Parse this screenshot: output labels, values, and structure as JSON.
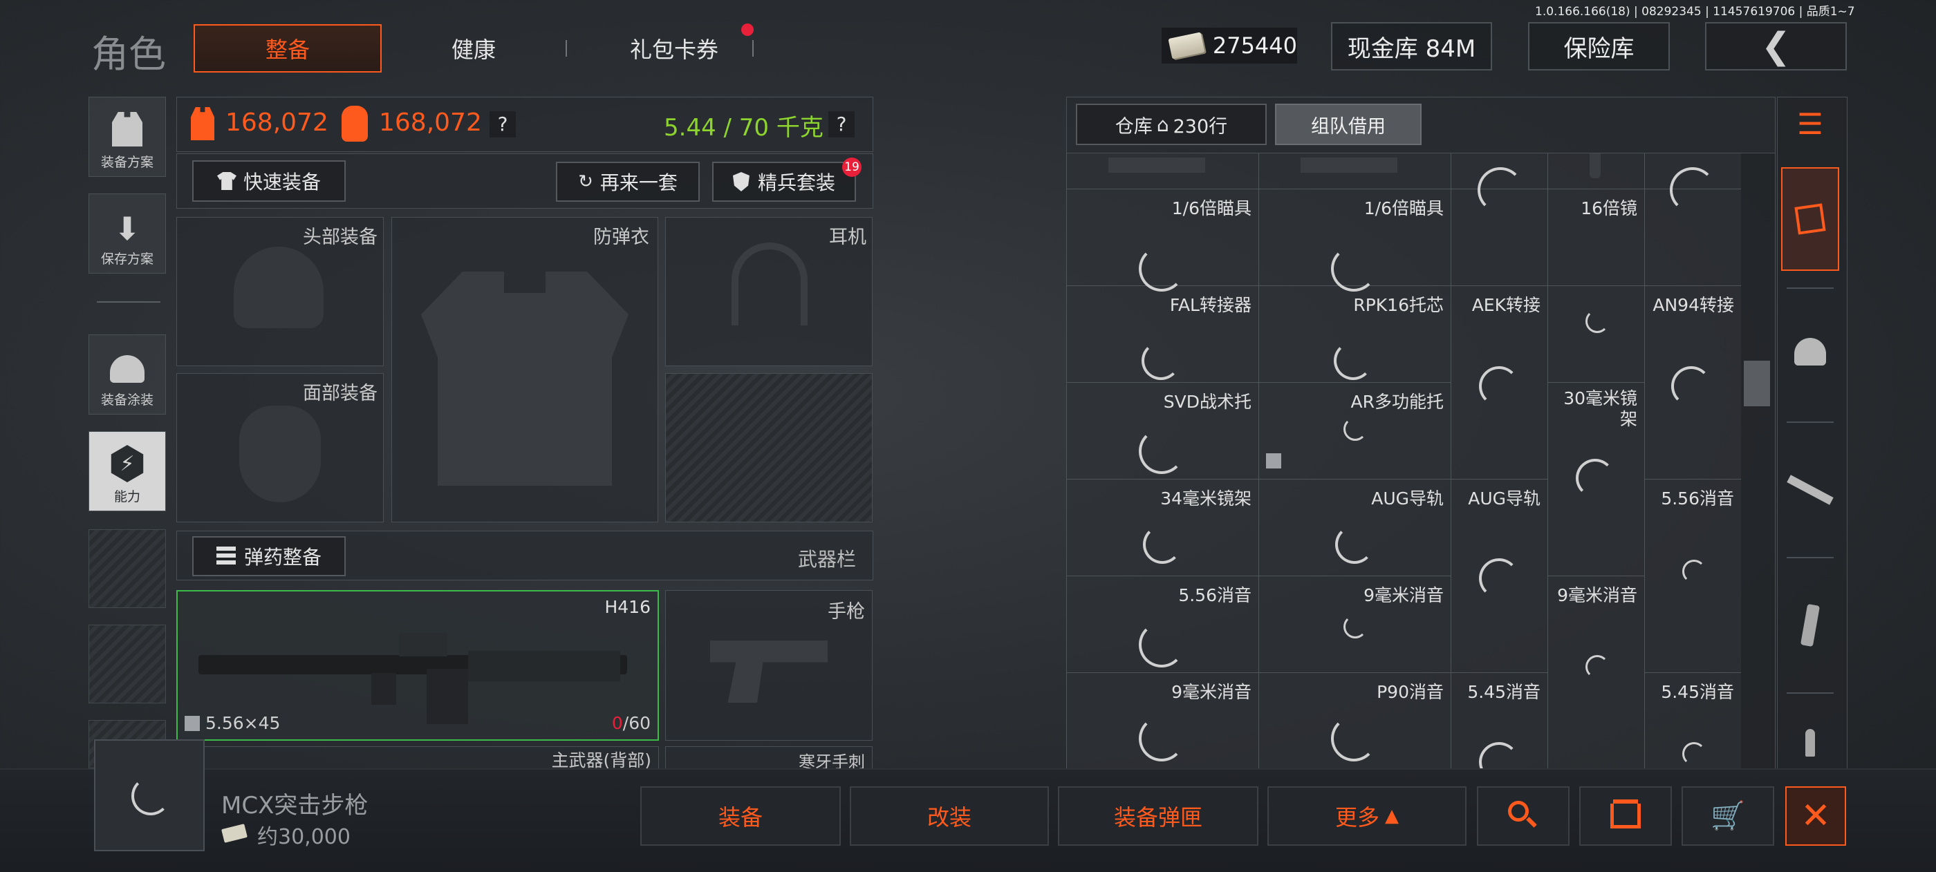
{
  "version_info": "1.0.166.166(18) | 08292345 | 11457619706 | 品质1~7",
  "header": {
    "title": "角色",
    "tabs": [
      {
        "label": "整备",
        "active": true
      },
      {
        "label": "健康",
        "active": false
      },
      {
        "label": "礼包卡券",
        "active": false
      }
    ],
    "currency_value": "275440",
    "cash_vault": "现金库 84M",
    "safe_box": "保险库"
  },
  "left_sidebar": {
    "items": [
      {
        "label": "装备方案",
        "icon": "vest-icon"
      },
      {
        "label": "保存方案",
        "icon": "download-icon"
      },
      {
        "label": "装备涂装",
        "icon": "helmet-paint-icon"
      },
      {
        "label": "能力",
        "icon": "ability-icon"
      }
    ]
  },
  "loadout": {
    "armor_value_1": "168,072",
    "armor_value_2": "168,072",
    "weight": "5.44 / 70 千克",
    "help": "?",
    "quick_equip": "快速装备",
    "another_set": "再来一套",
    "elite_set": "精兵套装",
    "elite_badge": "19",
    "slots": {
      "head": "头部装备",
      "armor": "防弹衣",
      "earphone": "耳机",
      "face": "面部装备"
    },
    "ammo_equip": "弹药整备",
    "weapon_bar": "武器栏",
    "primary": {
      "name": "H416",
      "ammo_type": "5.56×45",
      "ammo_current": "0",
      "ammo_max": "/60",
      "slot": "主武器(背部)"
    },
    "pistol": {
      "name": "手枪",
      "slot": "寒牙手刺"
    }
  },
  "warehouse": {
    "tab_storage": "仓库",
    "rows": "230行",
    "tab_team": "组队借用",
    "items": [
      [
        "1/6倍瞄具",
        "1/6倍瞄具",
        "",
        "16倍镜",
        ""
      ],
      [
        "FAL转接器",
        "RPK16托芯",
        "AEK转接",
        "",
        "AN94转接"
      ],
      [
        "SVD战术托",
        "AR多功能托",
        "",
        "30毫米镜架",
        ""
      ],
      [
        "34毫米镜架",
        "AUG导轨",
        "AUG导轨",
        "",
        "5.56消音"
      ],
      [
        "5.56消音",
        "9毫米消音",
        "9毫米消音",
        "",
        ""
      ],
      [
        "9毫米消音",
        "P90消音",
        "5.45消音",
        "",
        "5.45消音"
      ]
    ]
  },
  "bottom_bar": {
    "selected_name": "MCX突击步枪",
    "selected_price": "约30,000",
    "equip": "装备",
    "modify": "改装",
    "equip_mag": "装备弹匣",
    "more": "更多"
  },
  "colors": {
    "accent": "#ff5a1e",
    "weight_green": "#8ed42e",
    "selected_border": "#3dbb4a",
    "badge_red": "#e8203a"
  }
}
